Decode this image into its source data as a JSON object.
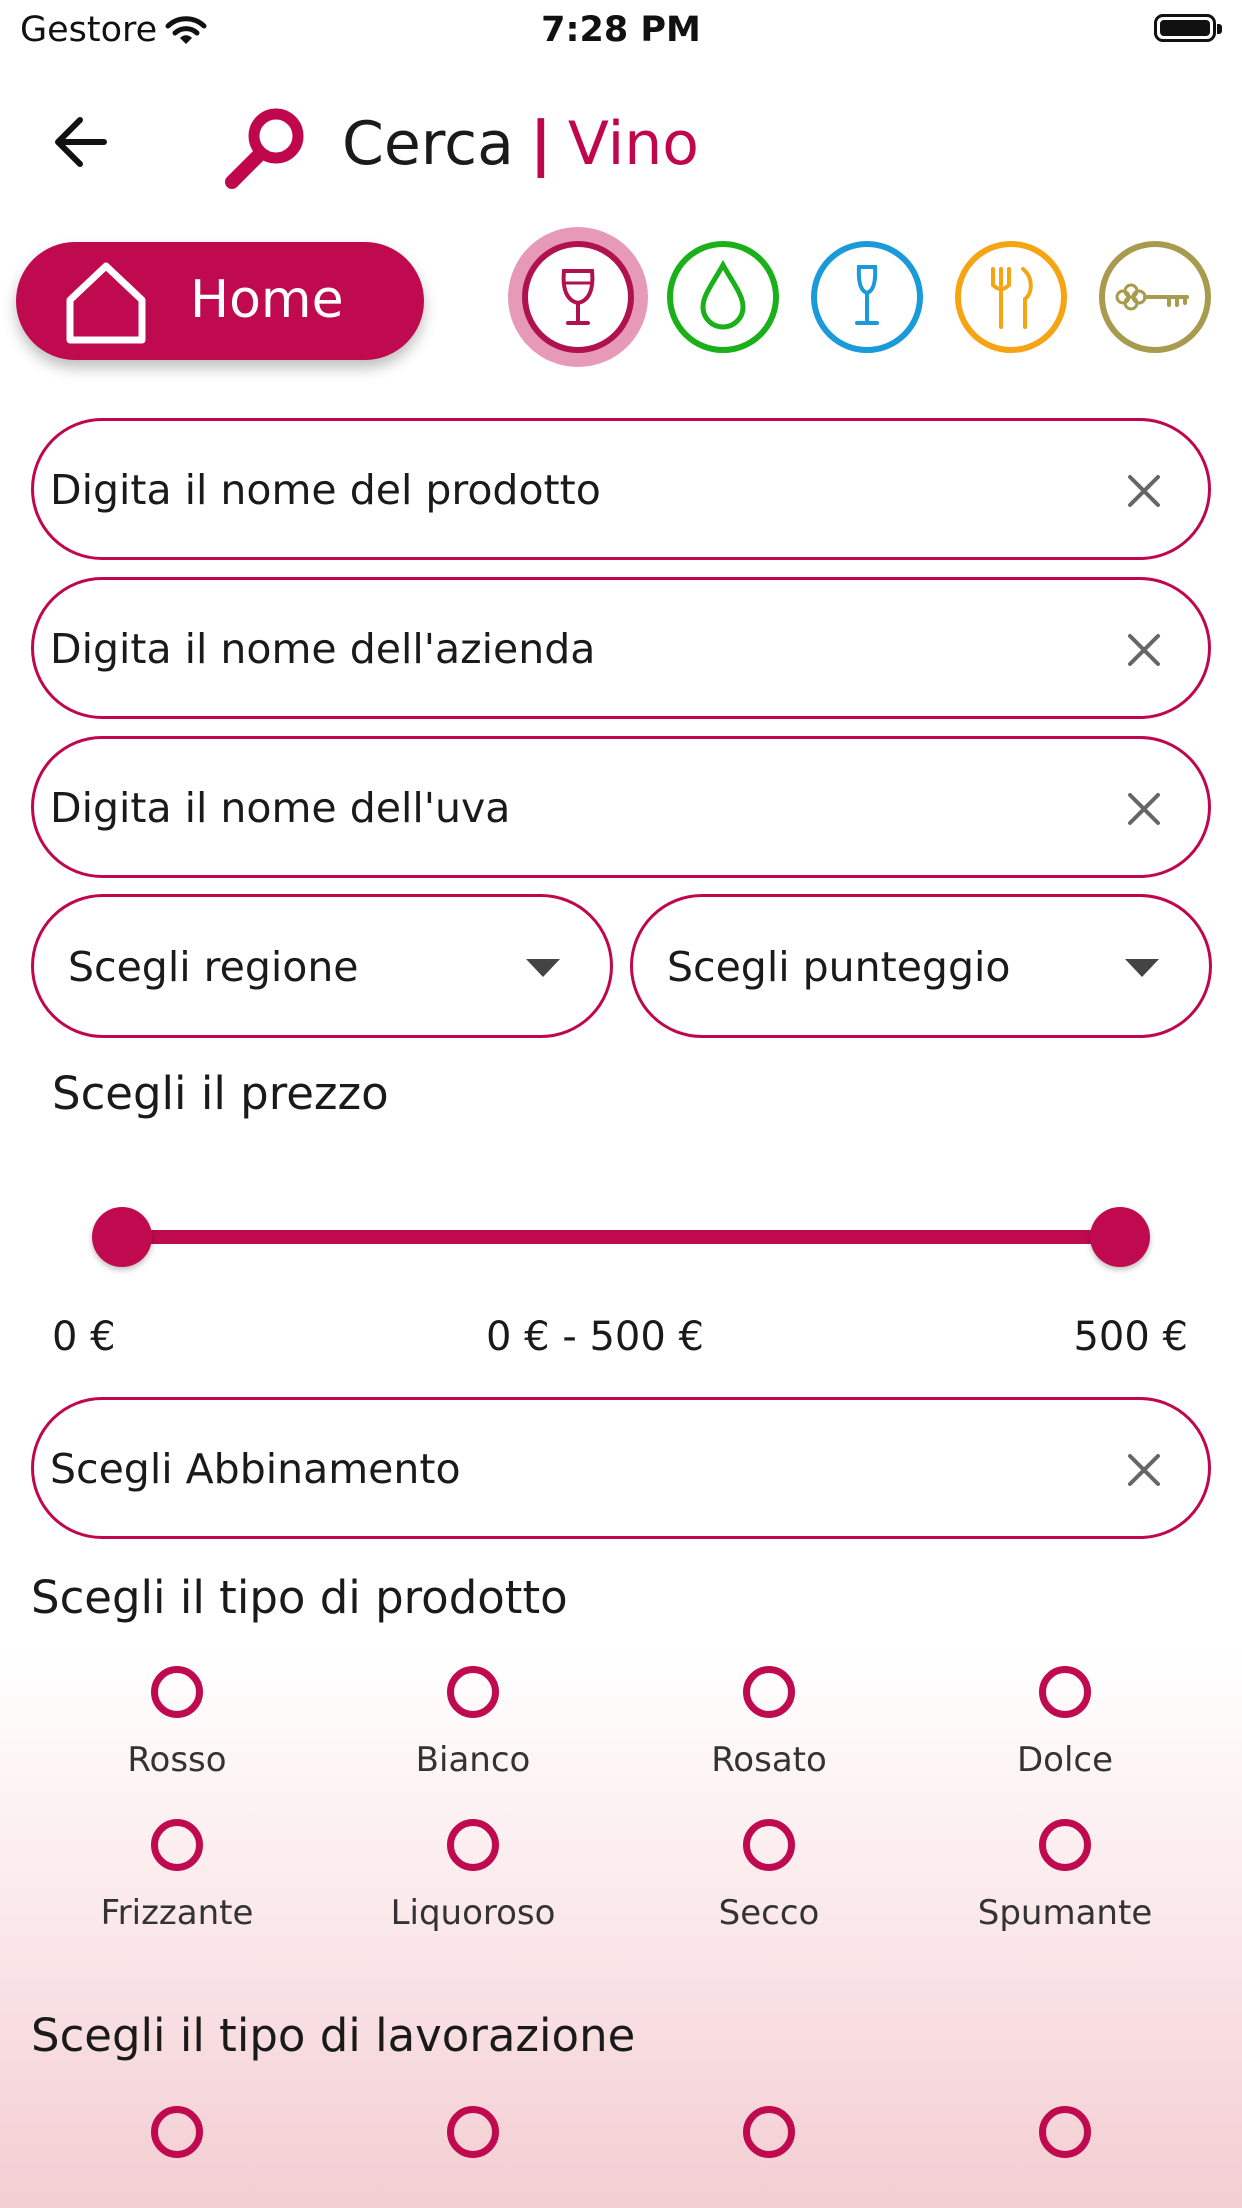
{
  "status": {
    "carrier": "Gestore",
    "time": "7:28 PM"
  },
  "header": {
    "title": "Cerca",
    "separator": "|",
    "subtitle": "Vino"
  },
  "home": {
    "label": "Home"
  },
  "categories": [
    {
      "icon": "wine-glass-icon",
      "color": "#b0124f",
      "selected": true
    },
    {
      "icon": "water-drop-icon",
      "color": "#1ab01a"
    },
    {
      "icon": "spirit-glass-icon",
      "color": "#1a9ad8"
    },
    {
      "icon": "fork-knife-icon",
      "color": "#f5a414"
    },
    {
      "icon": "key-icon",
      "color": "#a89b4e"
    }
  ],
  "fields": {
    "product": {
      "placeholder": "Digita il nome del prodotto",
      "value": ""
    },
    "company": {
      "placeholder": "Digita il nome dell'azienda",
      "value": ""
    },
    "grape": {
      "placeholder": "Digita il nome dell'uva",
      "value": ""
    },
    "pairing": {
      "placeholder": "Scegli Abbinamento",
      "value": ""
    }
  },
  "dropdowns": {
    "region": "Scegli regione",
    "score": "Scegli punteggio"
  },
  "price": {
    "title": "Scegli il prezzo",
    "min_label": "0 €",
    "range_label": "0 € - 500 €",
    "max_label": "500 €",
    "min": 0,
    "max": 500,
    "selected_low": 0,
    "selected_high": 500
  },
  "product_type": {
    "title": "Scegli il tipo di prodotto",
    "options": [
      "Rosso",
      "Bianco",
      "Rosato",
      "Dolce",
      "Frizzante",
      "Liquoroso",
      "Secco",
      "Spumante"
    ]
  },
  "processing_type": {
    "title": "Scegli il tipo di lavorazione"
  },
  "colors": {
    "accent": "#c00a4f"
  }
}
